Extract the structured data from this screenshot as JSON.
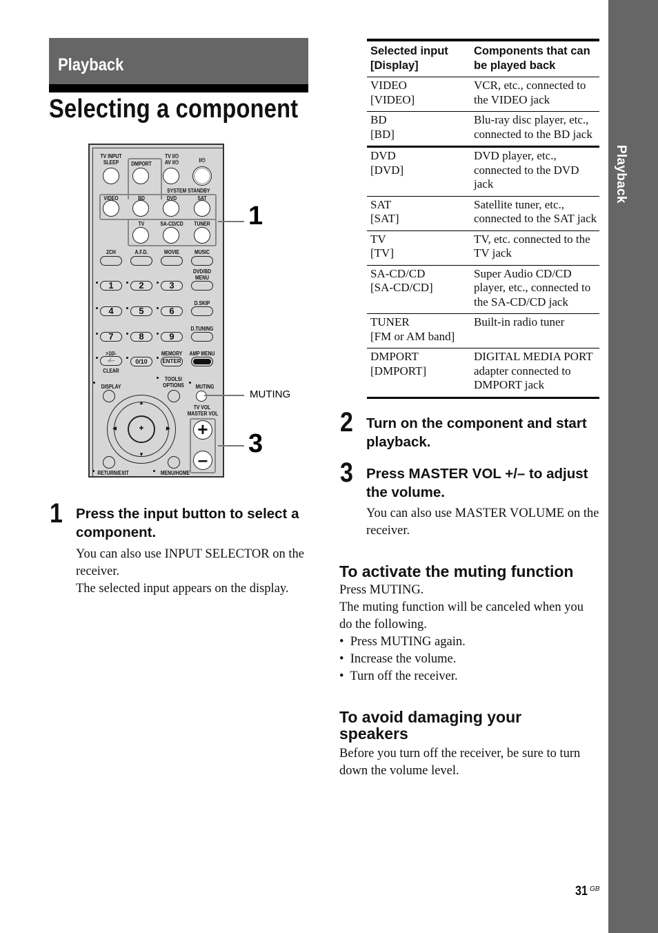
{
  "side_tab": {
    "label": "Playback"
  },
  "section": {
    "title": "Playback"
  },
  "page_title": "Selecting a component",
  "remote": {
    "labels": {
      "tv_input_sleep": "TV INPUT\nSLEEP",
      "dmport": "DMPORT",
      "tv_av_power": "TV I/⏻\nAV I/⏻",
      "power": "I/⏻",
      "system_standby": "SYSTEM STANDBY",
      "video": "VIDEO",
      "bd": "BD",
      "dvd": "DVD",
      "sat": "SAT",
      "tv": "TV",
      "sacd": "SA-CD/CD",
      "tuner": "TUNER",
      "two_ch": "2CH",
      "afd": "A.F.D.",
      "movie": "MOVIE",
      "music": "MUSIC",
      "dvd_bd_menu": "DVD/BD\nMENU",
      "d_skip": "D.SKIP",
      "d_tuning": "D.TUNING",
      "ten": ">10/-",
      "clear": "CLEAR",
      "dash": "-/--",
      "zero": "0/10",
      "memory": "MEMORY",
      "enter": "ENTER",
      "amp_menu": "AMP MENU",
      "display": "DISPLAY",
      "tools": "TOOLS/\nOPTIONS",
      "muting": "MUTING",
      "tv_vol": "TV VOL\nMASTER VOL",
      "return": "RETURN/EXIT",
      "menu_home": "MENU/HOME",
      "plus": "+",
      "minus": "–"
    },
    "digits": [
      "1",
      "2",
      "3",
      "4",
      "5",
      "6",
      "7",
      "8",
      "9"
    ],
    "callouts": {
      "one": "1",
      "muting": "MUTING",
      "three": "3"
    }
  },
  "steps": [
    {
      "number": "1",
      "heading": "Press the input button to select a component.",
      "body": [
        "You can also use INPUT SELECTOR on the receiver.",
        "The selected input appears on the display."
      ]
    },
    {
      "number": "2",
      "heading": "Turn on the component and start playback.",
      "body": []
    },
    {
      "number": "3",
      "heading": "Press MASTER VOL +/– to adjust the volume.",
      "body": [
        "You can also use MASTER VOLUME on the receiver."
      ]
    }
  ],
  "table": {
    "headers": [
      "Selected input [Display]",
      "Components that can be played back"
    ],
    "rows": [
      {
        "input": "VIDEO",
        "display": "[VIDEO]",
        "components": "VCR, etc., connected to the VIDEO jack"
      },
      {
        "input": "BD",
        "display": "[BD]",
        "components": "Blu-ray disc player, etc., connected to the BD jack"
      },
      {
        "input": "DVD",
        "display": "[DVD]",
        "components": "DVD player, etc., connected to the DVD jack"
      },
      {
        "input": "SAT",
        "display": "[SAT]",
        "components": "Satellite tuner, etc., connected to the SAT jack"
      },
      {
        "input": "TV",
        "display": "[TV]",
        "components": "TV, etc. connected to the TV jack"
      },
      {
        "input": "SA-CD/CD",
        "display": "[SA-CD/CD]",
        "components": "Super Audio CD/CD player, etc., connected to the SA-CD/CD jack"
      },
      {
        "input": "TUNER",
        "display": "[FM or AM band]",
        "components": "Built-in radio tuner"
      },
      {
        "input": "DMPORT",
        "display": "[DMPORT]",
        "components": "DIGITAL MEDIA PORT adapter connected to DMPORT jack"
      }
    ]
  },
  "muting": {
    "heading": "To activate the muting function",
    "lines": [
      "Press MUTING.",
      "The muting function will be canceled when you do the following."
    ],
    "bullets": [
      "Press MUTING again.",
      "Increase the volume.",
      "Turn off the receiver."
    ]
  },
  "speakers": {
    "heading": "To avoid damaging your speakers",
    "body": "Before you turn off the receiver, be sure to turn down the volume level."
  },
  "footer": {
    "page_number": "31",
    "suffix": "GB"
  }
}
